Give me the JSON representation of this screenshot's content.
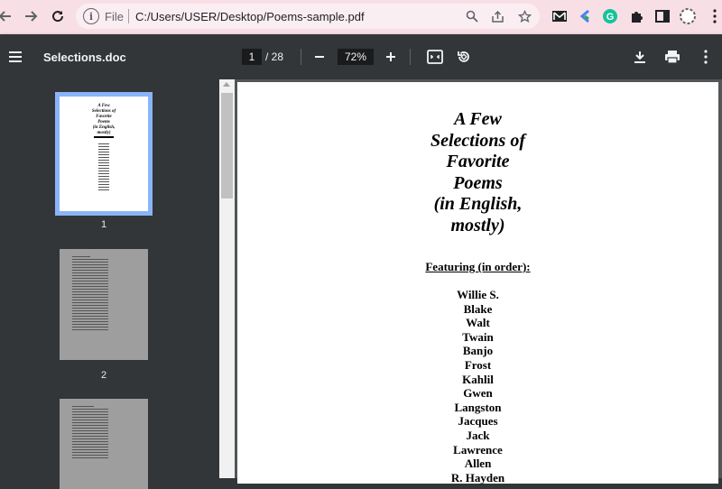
{
  "browser": {
    "scheme": "File",
    "url": "C:/Users/USER/Desktop/Poems-sample.pdf"
  },
  "toolbar": {
    "title": "Selections.doc",
    "current_page": "1",
    "total_pages": "/ 28",
    "zoom": "72%"
  },
  "sidebar": {
    "thumbnails": [
      {
        "label": "1"
      },
      {
        "label": "2"
      }
    ],
    "mini_title": [
      "A Few",
      "Selections of",
      "Favorite",
      "Poems",
      "(in English,",
      "mostly)"
    ]
  },
  "document": {
    "title_lines": [
      "A Few",
      "Selections of",
      "Favorite",
      "Poems",
      "(in English,",
      "mostly)"
    ],
    "featuring": "Featuring (in order):",
    "names": [
      "Willie S.",
      "Blake",
      "Walt",
      "Twain",
      "Banjo",
      "Frost",
      "Kahlil",
      "Gwen",
      "Langston",
      "Jacques",
      "Jack",
      "Lawrence",
      "Allen",
      "R. Hayden"
    ]
  },
  "colors": {
    "tab_strip": "#f8dfe6",
    "toolbar": "#323639",
    "selected_thumb_border": "#8ab4f8"
  }
}
